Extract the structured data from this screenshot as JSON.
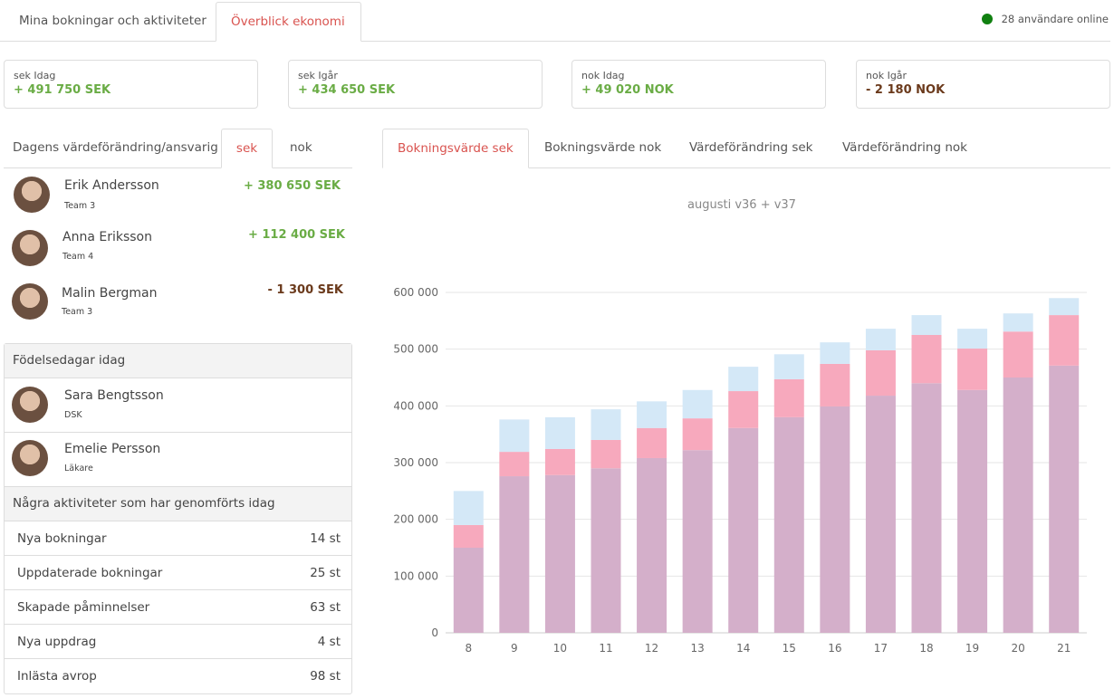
{
  "top_tabs": [
    {
      "label": "Mina bokningar och aktiviteter"
    },
    {
      "label": "Överblick ekonomi",
      "active": true
    }
  ],
  "online": {
    "text": "28 användare online",
    "color": "#108010"
  },
  "cards": [
    {
      "label": "sek Idag",
      "value": "+ 491 750 SEK",
      "sign": "pos"
    },
    {
      "label": "sek Igår",
      "value": "+ 434 650 SEK",
      "sign": "pos"
    },
    {
      "label": "nok Idag",
      "value": "+ 49 020 NOK",
      "sign": "pos"
    },
    {
      "label": "nok Igår",
      "value": "- 2 180 NOK",
      "sign": "neg"
    }
  ],
  "left_tabs": {
    "title": "Dagens värdeförändring/ansvarig",
    "tabs": [
      "sek",
      "nok"
    ],
    "active": "sek"
  },
  "people": [
    {
      "name": "Erik Andersson",
      "team": "Team 3",
      "value": "+ 380 650 SEK"
    },
    {
      "name": "Anna Eriksson",
      "team": "Team 4",
      "value": "+ 112 400 SEK"
    },
    {
      "name": "Malin Bergman",
      "team": "Team 3",
      "value": "- 1 300 SEK"
    }
  ],
  "birthdays": {
    "title": "Födelsedagar idag",
    "items": [
      {
        "name": "Sara Bengtsson",
        "role": "DSK"
      },
      {
        "name": "Emelie Persson",
        "role": "Läkare"
      }
    ]
  },
  "activities": {
    "title": "Några aktiviteter som har genomförts idag",
    "items": [
      {
        "label": "Nya bokningar",
        "value": "14 st"
      },
      {
        "label": "Uppdaterade bokningar",
        "value": "25 st"
      },
      {
        "label": "Skapade påminnelser",
        "value": "63 st"
      },
      {
        "label": "Nya uppdrag",
        "value": "4 st"
      },
      {
        "label": "Inlästa avrop",
        "value": "98 st"
      }
    ]
  },
  "chart_tabs": [
    "Bokningsvärde sek",
    "Bokningsvärde nok",
    "Värdeförändring sek",
    "Värdeförändring nok"
  ],
  "chart_data": {
    "type": "bar",
    "stacked": true,
    "title": "augusti v36 + v37",
    "categories": [
      "8",
      "9",
      "10",
      "11",
      "12",
      "13",
      "14",
      "15",
      "16",
      "17",
      "18",
      "19",
      "20",
      "21"
    ],
    "ylim": [
      0,
      600000
    ],
    "yticks": [
      "0",
      "100 000",
      "200 000",
      "300 000",
      "400 000",
      "500 000",
      "600 000"
    ],
    "grid": true,
    "series": [
      {
        "color": "#d4afca",
        "values": [
          150000,
          276000,
          278000,
          290000,
          308000,
          322000,
          361000,
          380000,
          399000,
          418000,
          440000,
          428000,
          450000,
          471000
        ]
      },
      {
        "color": "#f7a9bd",
        "values": [
          40000,
          43000,
          46000,
          50000,
          53000,
          56000,
          65000,
          67000,
          75000,
          80000,
          85000,
          73000,
          81000,
          89000
        ]
      },
      {
        "color": "#d4e8f7",
        "values": [
          60000,
          57000,
          56000,
          54000,
          47000,
          50000,
          43000,
          44000,
          38000,
          38000,
          35000,
          35000,
          32000,
          30000
        ]
      }
    ]
  }
}
